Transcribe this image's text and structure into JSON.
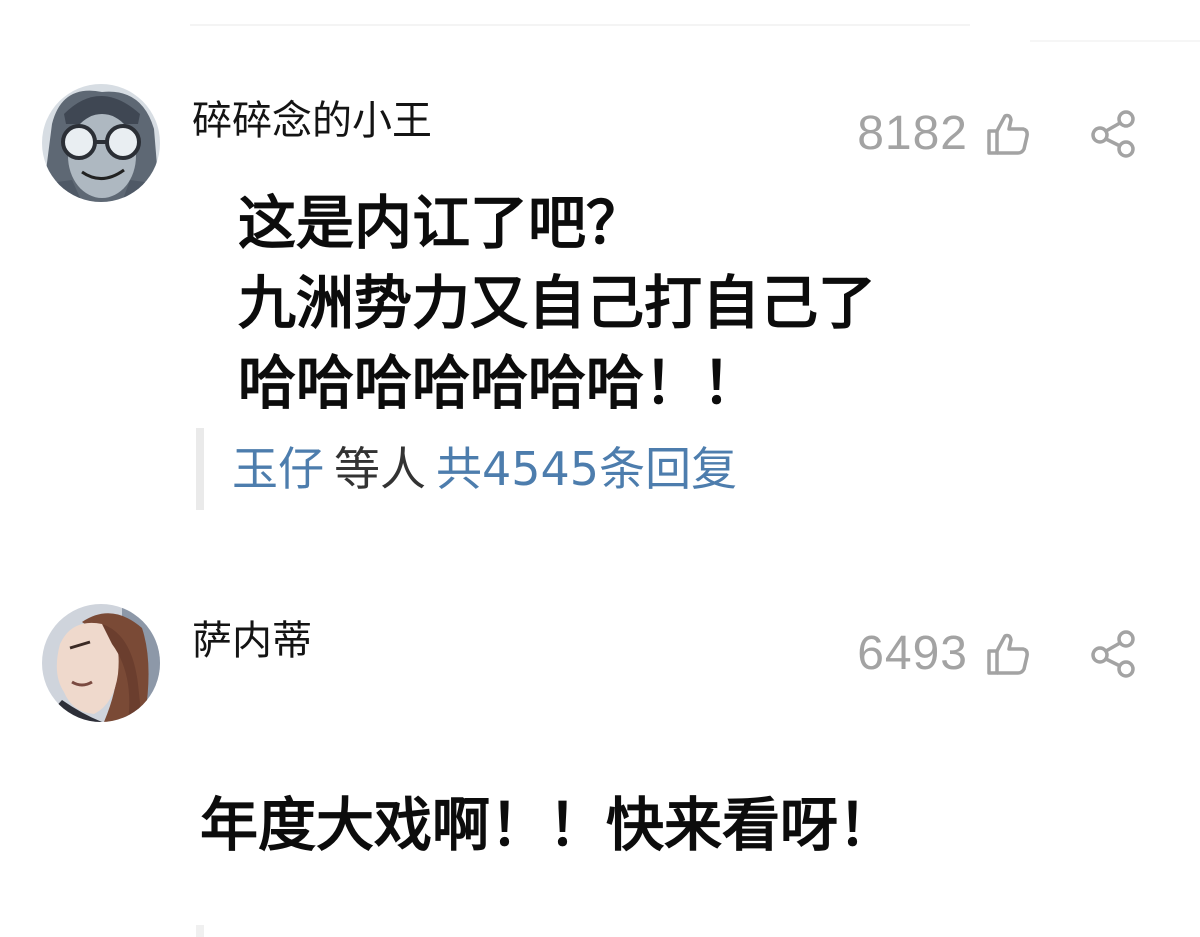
{
  "comments": [
    {
      "username": "碎碎念的小王",
      "likes": "8182",
      "body_lines": [
        "这是内讧了吧？",
        "九洲势力又自己打自己了",
        "哈哈哈哈哈哈哈！！"
      ],
      "replies": {
        "user": "玉仔",
        "others": "等人",
        "total": "共4545条回复"
      },
      "avatar_icon": "avatar-glasses-character",
      "like_icon": "thumbs-up-icon",
      "share_icon": "share-icon"
    },
    {
      "username": "萨内蒂",
      "likes": "6493",
      "body_lines": [
        "年度大戏啊！！快来看呀！"
      ],
      "avatar_icon": "avatar-longhair-character",
      "like_icon": "thumbs-up-icon",
      "share_icon": "share-icon"
    }
  ],
  "colors": {
    "link": "#4d7dad",
    "count": "#a3a3a3",
    "icon": "#a3a3a3",
    "text": "#0c0c0c"
  }
}
